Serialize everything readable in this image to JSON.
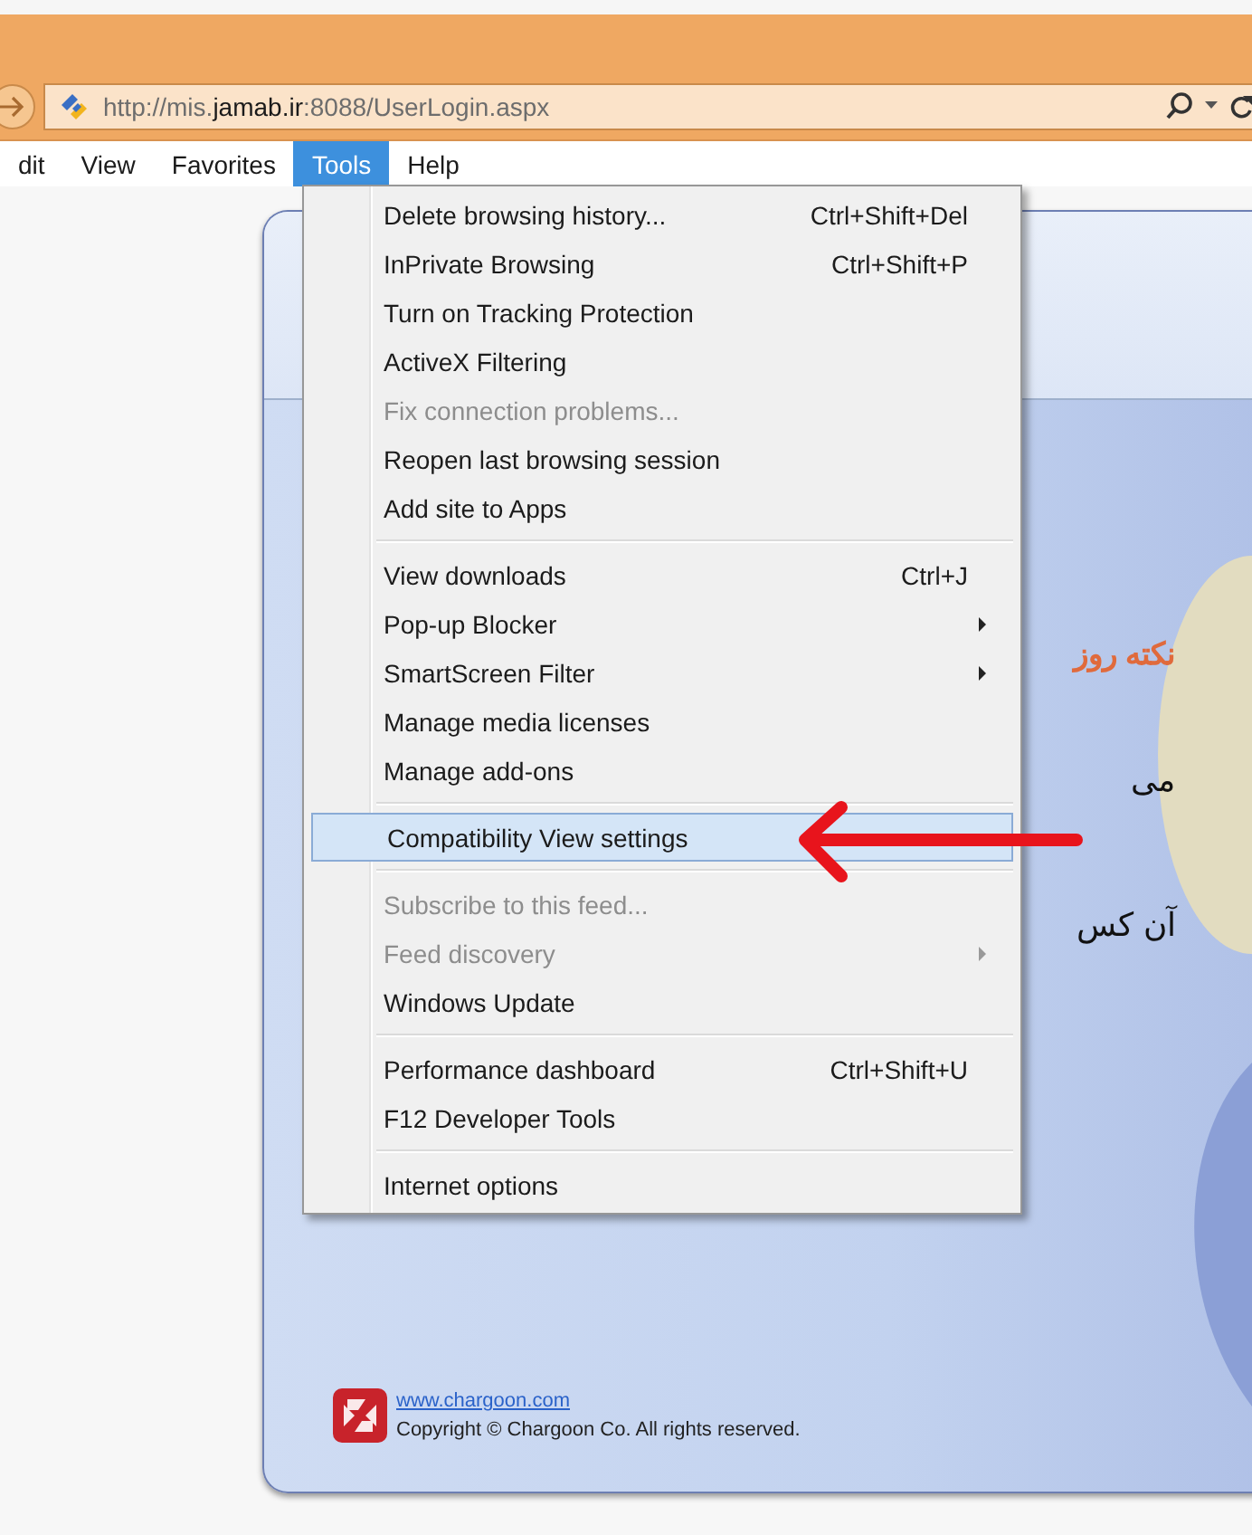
{
  "browser": {
    "address": "http://mis.**jamab.ir**:8088/UserLogin.aspx",
    "menubar": [
      {
        "label": "dit",
        "selected": false
      },
      {
        "label": "View",
        "selected": false
      },
      {
        "label": "Favorites",
        "selected": false
      },
      {
        "label": "Tools",
        "selected": true
      },
      {
        "label": "Help",
        "selected": false
      }
    ]
  },
  "tools_menu": {
    "groups": [
      {
        "items": [
          {
            "label": "Delete browsing history...",
            "shortcut": "Ctrl+Shift+Del",
            "submenu": false,
            "disabled": false,
            "selected": false
          },
          {
            "label": "InPrivate Browsing",
            "shortcut": "Ctrl+Shift+P",
            "submenu": false,
            "disabled": false,
            "selected": false
          },
          {
            "label": "Turn on Tracking Protection",
            "submenu": false,
            "disabled": false,
            "selected": false
          },
          {
            "label": "ActiveX Filtering",
            "submenu": false,
            "disabled": false,
            "selected": false
          },
          {
            "label": "Fix connection problems...",
            "submenu": false,
            "disabled": true,
            "selected": false
          },
          {
            "label": "Reopen last browsing session",
            "submenu": false,
            "disabled": false,
            "selected": false
          },
          {
            "label": "Add site to Apps",
            "submenu": false,
            "disabled": false,
            "selected": false
          }
        ]
      },
      {
        "items": [
          {
            "label": "View downloads",
            "shortcut": "Ctrl+J",
            "submenu": false,
            "disabled": false,
            "selected": false
          },
          {
            "label": "Pop-up Blocker",
            "submenu": true,
            "disabled": false,
            "selected": false
          },
          {
            "label": "SmartScreen Filter",
            "submenu": true,
            "disabled": false,
            "selected": false
          },
          {
            "label": "Manage media licenses",
            "submenu": false,
            "disabled": false,
            "selected": false
          },
          {
            "label": "Manage add-ons",
            "submenu": false,
            "disabled": false,
            "selected": false
          }
        ]
      },
      {
        "items": [
          {
            "label": "Compatibility View settings",
            "submenu": false,
            "disabled": false,
            "selected": true
          }
        ]
      },
      {
        "items": [
          {
            "label": "Subscribe to this feed...",
            "submenu": false,
            "disabled": true,
            "selected": false
          },
          {
            "label": "Feed discovery",
            "submenu": true,
            "disabled": true,
            "selected": false
          },
          {
            "label": "Windows Update",
            "submenu": false,
            "disabled": false,
            "selected": false
          }
        ]
      },
      {
        "items": [
          {
            "label": "Performance dashboard",
            "shortcut": "Ctrl+Shift+U",
            "submenu": false,
            "disabled": false,
            "selected": false
          },
          {
            "label": "F12 Developer Tools",
            "submenu": false,
            "disabled": false,
            "selected": false
          }
        ]
      },
      {
        "items": [
          {
            "label": "Internet options",
            "submenu": false,
            "disabled": false,
            "selected": false
          }
        ]
      }
    ]
  },
  "page": {
    "tip_title": "نکته روز",
    "tip_lines": [
      "می",
      "آن کس"
    ],
    "footer": {
      "link": "www.chargoon.com",
      "copyright": "Copyright © Chargoon Co. All rights reserved."
    }
  }
}
